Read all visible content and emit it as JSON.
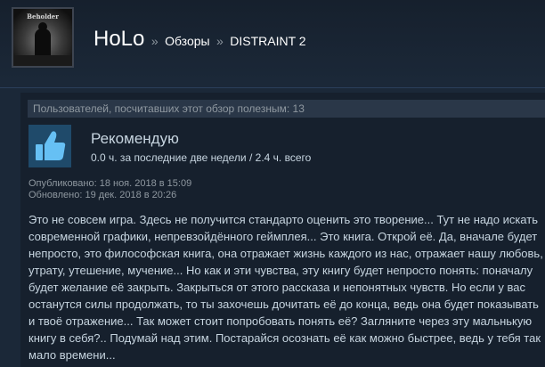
{
  "header": {
    "avatar_caption": "Beholder",
    "username": "HoLo",
    "separator": "»",
    "breadcrumb": [
      "Обзоры",
      "DISTRAINT 2"
    ]
  },
  "review": {
    "helpful_text": "Пользователей, посчитавших этот обзор полезным: 13",
    "recommendation": "Рекомендую",
    "hours": "0.0 ч. за последние две недели / 2.4 ч. всего",
    "published": "Опубликовано: 18 ноя. 2018 в 15:09",
    "updated": "Обновлено: 19 дек. 2018 в 20:26",
    "body": "Это не совсем игра. Здесь не получится стандарто оценить это творение... Тут не надо искать современной графики, непревзойдённого геймплея... Это книга. Открой её. Да, вначале будет непросто, это философская книга, она отражает жизнь каждого из нас, отражает нашу любовь, утрату, утешение, мучение... Но как и эти чувства, эту книгу будет непросто понять: поначалу будет желание её закрыть. Закрыться от этого рассказа и непонятных чувств. Но если у вас останутся силы продолжать, то ты захочешь дочитать её до конца, ведь она будет показывать и твоё отражение... Так может стоит попробовать понять её? Загляните через эту мальнькую книгу в себя?.. Подумай над этим. Постарайся осознать её как можно быстрее, ведь у тебя так мало времени..."
  },
  "colors": {
    "background": "#1b2838",
    "card": "#16202d",
    "helpful_bar": "#2a3748",
    "thumb_bg": "#1f4a6a",
    "thumb": "#66c0f4",
    "text": "#c6d4df",
    "muted": "#8f98a0"
  },
  "icons": {
    "recommendation": "thumbs-up-icon"
  }
}
